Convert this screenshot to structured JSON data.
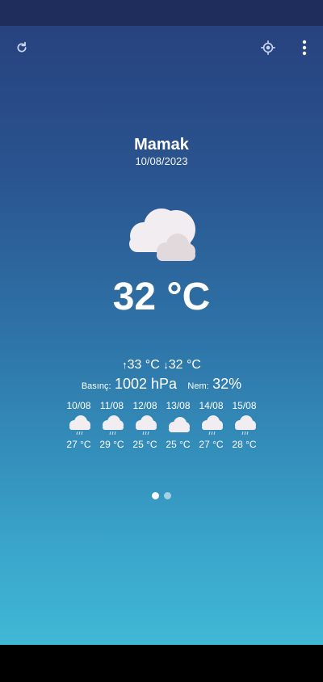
{
  "location": {
    "city": "Mamak",
    "date": "10/08/2023"
  },
  "current": {
    "temperature": "32 °C",
    "high": "33 °C",
    "low": "32 °C",
    "pressure_label": "Basınç:",
    "pressure_value": "1002 hPa",
    "humidity_label": "Nem:",
    "humidity_value": "32%",
    "condition_icon": "cloudy-icon"
  },
  "forecast": [
    {
      "date": "10/08",
      "temp": "27 °C",
      "icon": "rain-cloud-icon"
    },
    {
      "date": "11/08",
      "temp": "29 °C",
      "icon": "rain-cloud-icon"
    },
    {
      "date": "12/08",
      "temp": "25 °C",
      "icon": "rain-cloud-icon"
    },
    {
      "date": "13/08",
      "temp": "25 °C",
      "icon": "cloud-icon"
    },
    {
      "date": "14/08",
      "temp": "27 °C",
      "icon": "rain-cloud-icon"
    },
    {
      "date": "15/08",
      "temp": "28 °C",
      "icon": "rain-cloud-icon"
    }
  ],
  "toolbar": {
    "refresh_icon": "refresh-icon",
    "locate_icon": "gps-locate-icon",
    "menu_icon": "more-vertical-icon"
  },
  "pager": {
    "pages": 2,
    "active": 1
  }
}
